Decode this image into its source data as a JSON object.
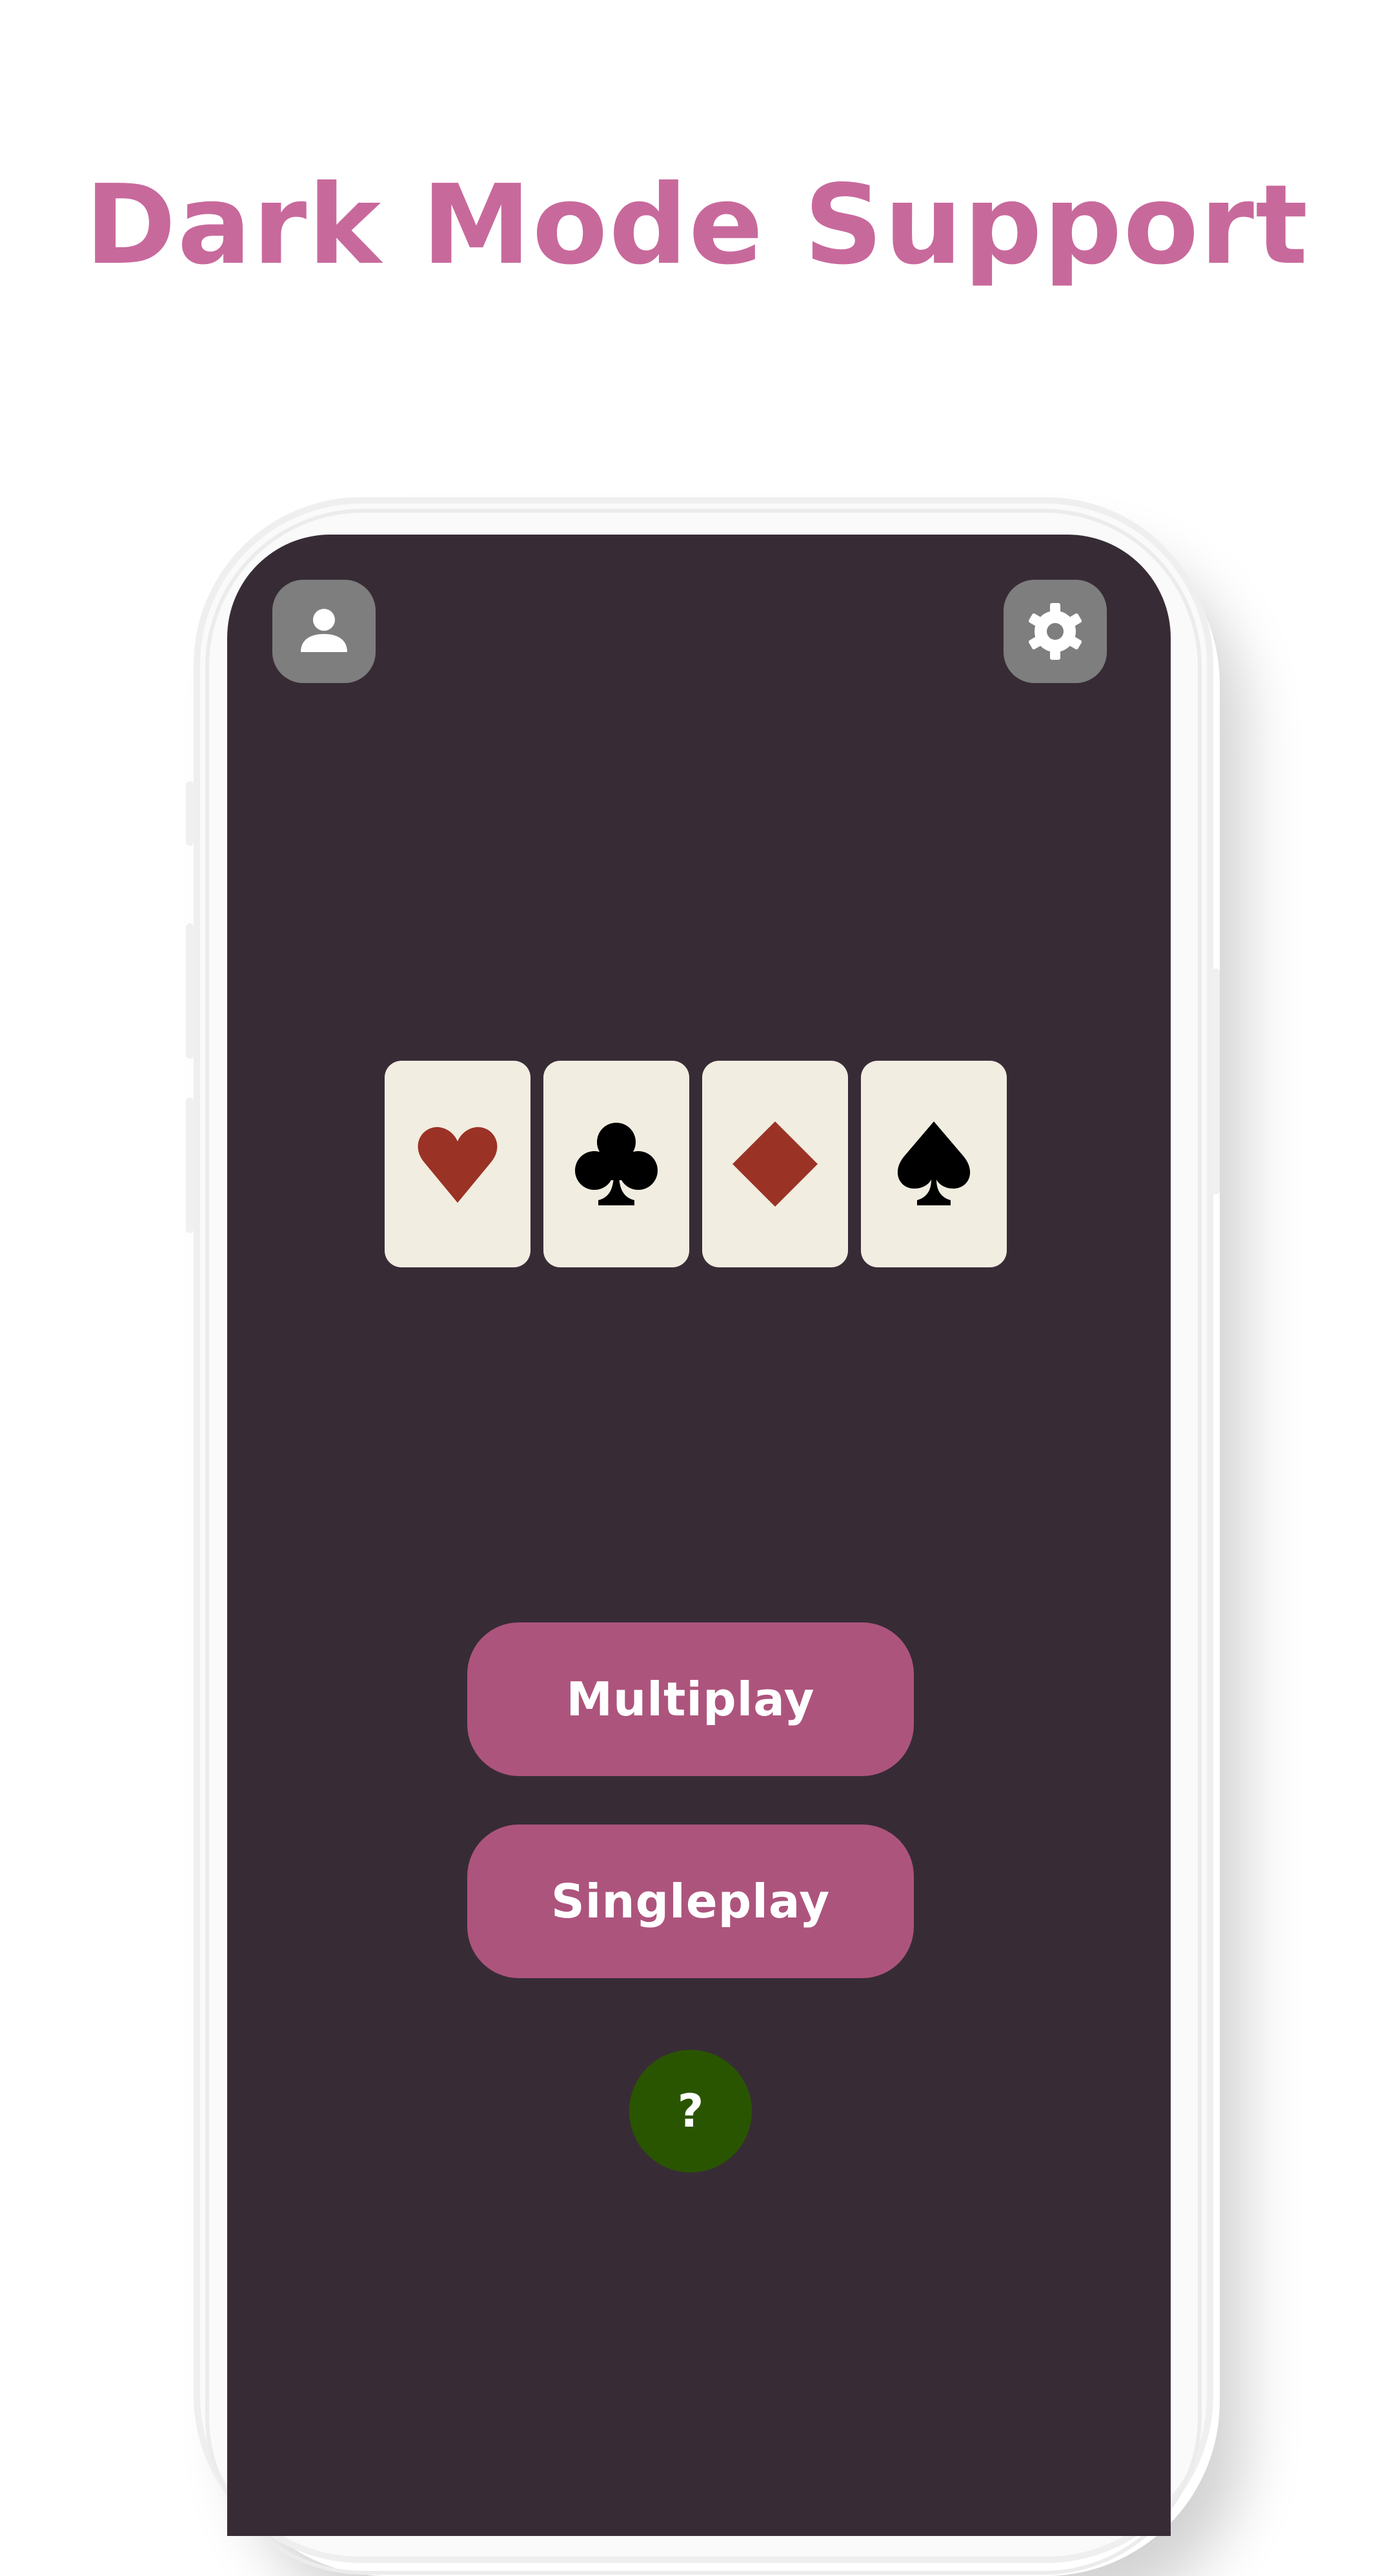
{
  "headline": {
    "text": "Dark Mode Support",
    "color": "#c8699c"
  },
  "phone": {
    "screen_background": "#372c36",
    "icon_button_background": "#7e7e7e"
  },
  "toolbar": {
    "profile_icon": "person-icon",
    "settings_icon": "gear-icon"
  },
  "cards": [
    {
      "suit": "hearts",
      "symbol": "♥",
      "color": "#9b3226"
    },
    {
      "suit": "clubs",
      "symbol": "♣",
      "color": "#000000"
    },
    {
      "suit": "diamonds",
      "symbol": "♦",
      "color": "#9b3226"
    },
    {
      "suit": "spades",
      "symbol": "♠",
      "color": "#000000"
    }
  ],
  "card_background": "#f1ede0",
  "buttons": {
    "multiplay_label": "Multiplay",
    "singleplay_label": "Singleplay",
    "background": "#ad547d"
  },
  "help": {
    "label": "?",
    "background": "#2a5500"
  }
}
